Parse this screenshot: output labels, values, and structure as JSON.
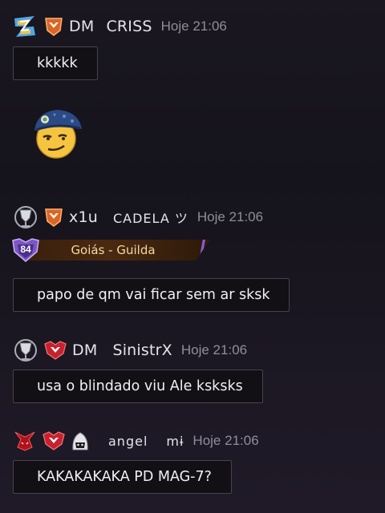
{
  "messages": [
    {
      "user": "DM",
      "user2": "CRISS",
      "time": "Hoje 21:06",
      "text": "kkkkk",
      "sticker": "cap-smirk-emoji"
    },
    {
      "user": "x1u",
      "user2": "CADELA ツ",
      "time": "Hoje 21:06",
      "guild": {
        "level": "84",
        "name": "Goiás - Guilda"
      },
      "text": "papo de qm vai ficar sem ar sksk"
    },
    {
      "user": "DM",
      "user2": "SinistrX",
      "time": "Hoje 21:06",
      "text": "usa o blindado viu Ale ksksks"
    },
    {
      "user": "angel",
      "user2": "mɨ",
      "time": "Hoje 21:06",
      "text": "KAKAKAKAKA PD MAG-7?"
    }
  ],
  "colors": {
    "bubble_border": "#46434d",
    "timestamp": "#8e8e99",
    "guild_gold": "#f4d9a0",
    "rank_orange": "#d9652a",
    "rank_red": "#c8212e"
  },
  "icons": [
    "z-rank-icon",
    "orange-rank-badge-icon",
    "silver-rank-badge-icon",
    "red-rank-badge-icon",
    "hooded-mask-icon",
    "red-devil-icon"
  ]
}
